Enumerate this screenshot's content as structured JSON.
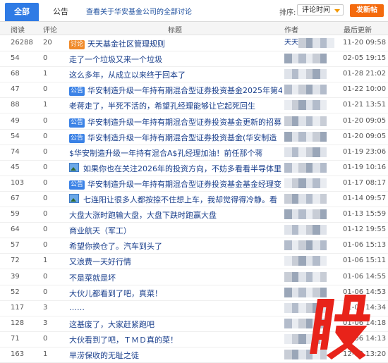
{
  "tabs": [
    {
      "label": "全部"
    },
    {
      "label": "公告"
    }
  ],
  "forum_link": "查看关于华安基金公司的全部讨论",
  "sort": {
    "label": "排序:",
    "value": "评论时间"
  },
  "post_button": "发新帖",
  "columns": {
    "read": "阅读",
    "comment": "评论",
    "title": "标题",
    "author": "作者",
    "updated": "最后更新"
  },
  "rows": [
    {
      "read": "26288",
      "comment": "20",
      "badge": "讨论",
      "title": "天天基金社区管理规则",
      "author": "天天",
      "time": "11-20 09:58"
    },
    {
      "read": "54",
      "comment": "0",
      "title": "走了一个垃圾又来一个垃圾",
      "author": "",
      "time": "02-05 19:15"
    },
    {
      "read": "68",
      "comment": "1",
      "title": "这么多年，从成立以来终于回本了",
      "author": "",
      "time": "01-28 21:02"
    },
    {
      "read": "47",
      "comment": "0",
      "badge": "公告",
      "title": "华安制造升级一年持有期混合型证券投资基金2025年第4",
      "author": "",
      "time": "01-22 10:00"
    },
    {
      "read": "88",
      "comment": "1",
      "title": "老蒋走了，半死不活的，希望孔经理能够让它起死回生",
      "author": "",
      "time": "01-21 13:51"
    },
    {
      "read": "49",
      "comment": "0",
      "badge": "公告",
      "title": "华安制造升级一年持有期混合型证券投资基金更新的招募",
      "author": "",
      "time": "01-20 09:05"
    },
    {
      "read": "54",
      "comment": "0",
      "badge": "公告",
      "title": "华安制造升级一年持有期混合型证券投资基金(华安制造",
      "author": "",
      "time": "01-20 09:05"
    },
    {
      "read": "74",
      "comment": "0",
      "title": "$华安制造升级一年持有混合A$孔经理加油！前任那个蒋",
      "author": "",
      "time": "01-19 23:06"
    },
    {
      "read": "45",
      "comment": "0",
      "image": true,
      "title": "如果你也在关注2026年的投资方向，不妨多看看半导体里",
      "author": "",
      "time": "01-19 10:16"
    },
    {
      "read": "103",
      "comment": "0",
      "badge": "公告",
      "title": "华安制造升级一年持有期混合型证券投资基金基金经理变",
      "author": "",
      "time": "01-17 08:17"
    },
    {
      "read": "67",
      "comment": "0",
      "image": true,
      "title": "七连阳让很多人都按捺不住想上车，我却觉得得冷静。看",
      "author": "",
      "time": "01-14 09:57"
    },
    {
      "read": "59",
      "comment": "0",
      "title": "大盘大涨时跑输大盘，大盘下跌时跑赢大盘",
      "author": "",
      "time": "01-13 15:59"
    },
    {
      "read": "64",
      "comment": "0",
      "title": "商业航天（军工）",
      "author": "",
      "time": "01-12 19:55"
    },
    {
      "read": "57",
      "comment": "0",
      "title": "希望你换仓了。汽车到头了",
      "author": "",
      "time": "01-06 15:13"
    },
    {
      "read": "72",
      "comment": "1",
      "title": "又浪费一天好行情",
      "author": "",
      "time": "01-06 15:11"
    },
    {
      "read": "39",
      "comment": "0",
      "title": "不是菜就是坏",
      "author": "",
      "time": "01-06 14:55"
    },
    {
      "read": "52",
      "comment": "0",
      "title": "大伙儿都看到了吧，真菜！",
      "author": "",
      "time": "01-06 14:53"
    },
    {
      "read": "117",
      "comment": "3",
      "title": "……",
      "author": "",
      "time": "01-06 14:34"
    },
    {
      "read": "128",
      "comment": "3",
      "title": "这基废了，大家赶紧跑吧",
      "author": "",
      "time": "01-06 14:18"
    },
    {
      "read": "71",
      "comment": "0",
      "title": "大伙看到了吧，ＴＭＤ真的菜！",
      "author": "",
      "time": "01-06 14:13"
    },
    {
      "read": "163",
      "comment": "1",
      "title": "旱涝保收的无耻之徒",
      "author": "",
      "time": "12-12 13:20"
    }
  ],
  "colors": {
    "accent": "#2f7be5",
    "post_button": "#f46a0d",
    "link": "#1a3f8c",
    "watermark": "#e8231a"
  }
}
